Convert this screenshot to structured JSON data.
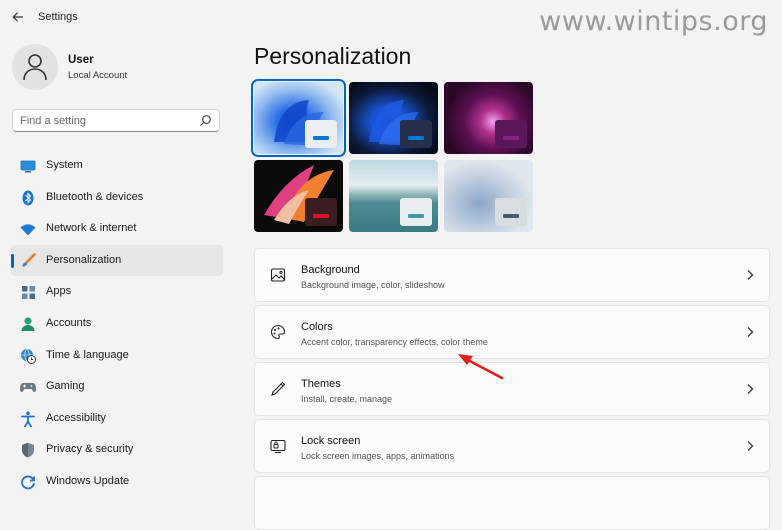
{
  "window": {
    "title": "Settings"
  },
  "watermark": "www.wintips.org",
  "user": {
    "name": "User",
    "account_type": "Local Account"
  },
  "search": {
    "placeholder": "Find a setting"
  },
  "nav": [
    {
      "label": "System",
      "icon": "monitor-icon",
      "active": false
    },
    {
      "label": "Bluetooth & devices",
      "icon": "bluetooth-icon",
      "active": false
    },
    {
      "label": "Network & internet",
      "icon": "wifi-icon",
      "active": false
    },
    {
      "label": "Personalization",
      "icon": "brush-icon",
      "active": true
    },
    {
      "label": "Apps",
      "icon": "apps-icon",
      "active": false
    },
    {
      "label": "Accounts",
      "icon": "person-icon",
      "active": false
    },
    {
      "label": "Time & language",
      "icon": "globe-clock-icon",
      "active": false
    },
    {
      "label": "Gaming",
      "icon": "gamepad-icon",
      "active": false
    },
    {
      "label": "Accessibility",
      "icon": "accessibility-icon",
      "active": false
    },
    {
      "label": "Privacy & security",
      "icon": "shield-icon",
      "active": false
    },
    {
      "label": "Windows Update",
      "icon": "update-icon",
      "active": false
    }
  ],
  "main": {
    "heading": "Personalization",
    "themes": [
      {
        "name": "windows-light",
        "selected": true,
        "accent": "#0078d4"
      },
      {
        "name": "windows-dark",
        "selected": false,
        "accent": "#0078d4"
      },
      {
        "name": "glow",
        "selected": false,
        "accent": "#8a1e8a"
      },
      {
        "name": "captured-motion",
        "selected": false,
        "accent": "#e81123"
      },
      {
        "name": "sunrise",
        "selected": false,
        "accent": "#3a96b0"
      },
      {
        "name": "flow",
        "selected": false,
        "accent": "#4a5a6a"
      }
    ],
    "cards": [
      {
        "title": "Background",
        "subtitle": "Background image, color, slideshow",
        "icon": "image-icon"
      },
      {
        "title": "Colors",
        "subtitle": "Accent color, transparency effects, color theme",
        "icon": "palette-icon"
      },
      {
        "title": "Themes",
        "subtitle": "Install, create, manage",
        "icon": "pen-icon"
      },
      {
        "title": "Lock screen",
        "subtitle": "Lock screen images, apps, animations",
        "icon": "lock-screen-icon"
      }
    ]
  },
  "colors": {
    "accent": "#0067c0",
    "annotation_arrow": "#e0201c"
  }
}
